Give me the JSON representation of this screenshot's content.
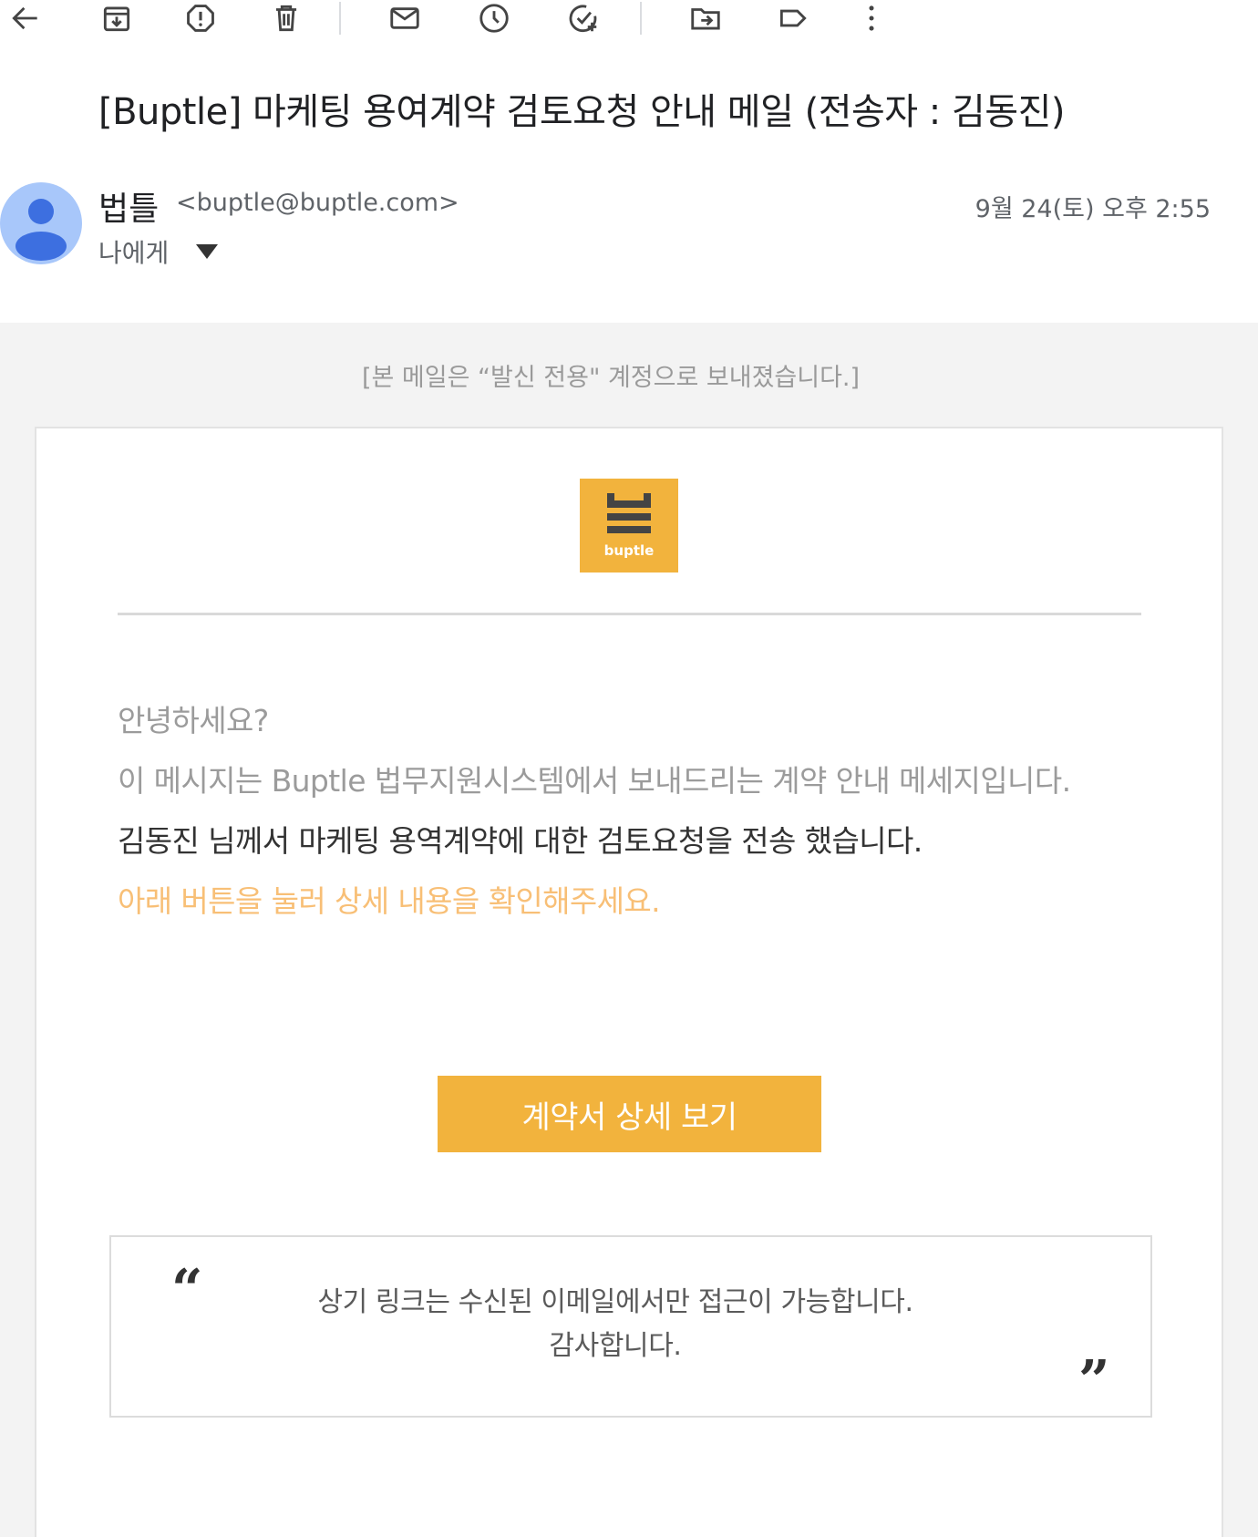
{
  "toolbar": {
    "icons": [
      "back-arrow-icon",
      "archive-icon",
      "report-spam-icon",
      "delete-icon",
      "mark-unread-icon",
      "snooze-icon",
      "add-task-icon",
      "move-to-icon",
      "label-icon",
      "more-vert-icon"
    ]
  },
  "subject": "[Buptle] 마케팅 용여계약 검토요청 안내 메일 (전송자 : 김동진)",
  "sender": {
    "name": "법틀",
    "email": "<buptle@buptle.com>",
    "date": "9월 24(토) 오후 2:55",
    "recipient": "나에게"
  },
  "mail": {
    "notice": "[본 메일은 “발신 전용\" 계정으로 보내졌습니다.]",
    "logo_text": "buptle",
    "greeting": "안녕하세요?",
    "line2": "이 메시지는 Buptle 법무지원시스템에서 보내드리는 계약 안내 메세지입니다.",
    "line3": "김동진 님께서 마케팅 용역계약에 대한 검토요청을 전송 했습니다.",
    "line4": "아래 버튼을 눌러 상세 내용을 확인해주세요.",
    "cta_label": "계약서 상세 보기",
    "quote_open": "“",
    "quote_close": "”",
    "quote_line1": "상기 링크는 수신된 이메일에서만 접근이 가능합니다.",
    "quote_line2": "감사합니다."
  },
  "colors": {
    "brand": "#f2b33d",
    "highlight_text": "#f8bf76",
    "avatar_bg": "#a8c7fa"
  }
}
